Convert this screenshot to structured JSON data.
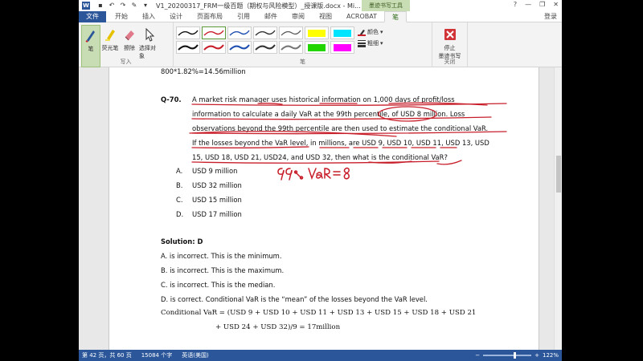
{
  "titlebar": {
    "logo": "W",
    "document_title": "V1_20200317_FRM一级百题（期权与风险模型）_授课版.docx - Mi...",
    "tool_tab": "墨迹书写工具",
    "help": "?",
    "minimize": "—",
    "restore": "❐",
    "close": "✕"
  },
  "tabs": {
    "file": "文件",
    "items": [
      "开始",
      "插入",
      "设计",
      "页面布局",
      "引用",
      "邮件",
      "审阅",
      "视图",
      "ACROBAT"
    ],
    "active": "笔",
    "login": "登录"
  },
  "ribbon": {
    "write_group": {
      "label": "写入",
      "buttons": [
        "笔",
        "荧光笔",
        "擦除",
        "选择对象"
      ]
    },
    "pens_group": {
      "label": "笔",
      "color_label": "颜色",
      "thickness_label": "粗细"
    },
    "close_group": {
      "label": "关闭",
      "stop_label_1": "停止",
      "stop_label_2": "墨迹书写"
    }
  },
  "document": {
    "prev_line": "800*1.82%=14.56million",
    "question_label": "Q-70.",
    "question_lines": [
      "A market risk manager uses historical information on 1,000 days of profit/loss",
      "information to calculate a daily VaR at the 99th percentile, of USD 8 million. Loss",
      "observations beyond the 99th percentile are then used to estimate the conditional VaR.",
      "If the losses beyond the VaR level, in millions, are USD 9, USD 10, USD 11, USD 13, USD",
      "15, USD 18, USD 21, USD24, and USD 32, then what is the conditional VaR?"
    ],
    "options": [
      {
        "letter": "A.",
        "text": "USD 9 million"
      },
      {
        "letter": "B.",
        "text": "USD 32 million"
      },
      {
        "letter": "C.",
        "text": "USD 15 million"
      },
      {
        "letter": "D.",
        "text": "USD 17 million"
      }
    ],
    "solution_title": "Solution: D",
    "solution_lines": [
      "A. is incorrect. This is the minimum.",
      "B. is incorrect. This is the maximum.",
      "C. is incorrect. This is the median.",
      "D. is correct. Conditional VaR is the “mean” of the losses beyond the VaR level."
    ],
    "formula_line_1": "Conditional VaR = (USD 9 + USD 10 + USD 11 + USD 13 + USD 15 + USD 18 + USD 21",
    "formula_line_2": "+ USD 24 + USD 32)/9 = 17million",
    "handwriting": "99% VaR = 8"
  },
  "statusbar": {
    "page": "第 42 页，共 60 页",
    "words": "15084 个字",
    "language": "英语(美国)",
    "zoom": "122%"
  },
  "colors": {
    "ink_red": "#c81e2a",
    "word_blue": "#2b579a",
    "tool_green": "#c9ddb4"
  }
}
